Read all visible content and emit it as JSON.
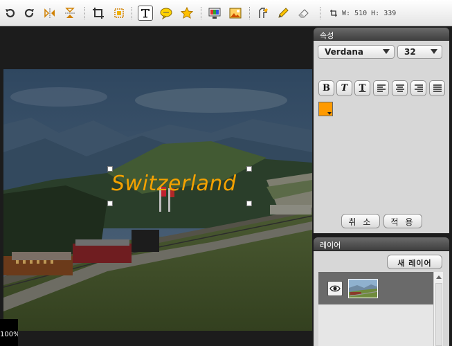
{
  "toolbar": {
    "tools": [
      {
        "name": "undo-icon"
      },
      {
        "name": "redo-icon"
      },
      {
        "name": "flip-horizontal-icon"
      },
      {
        "name": "flip-vertical-icon"
      },
      {
        "name": "crop-icon"
      },
      {
        "name": "resize-icon"
      },
      {
        "name": "text-tool-icon"
      },
      {
        "name": "speech-bubble-icon"
      },
      {
        "name": "star-icon"
      },
      {
        "name": "color-adjust-icon"
      },
      {
        "name": "image-filter-icon"
      },
      {
        "name": "brush-icon"
      },
      {
        "name": "pencil-icon"
      },
      {
        "name": "eraser-icon"
      }
    ],
    "size_label": "W: 510 H: 339"
  },
  "canvas": {
    "overlay_text": "Switzerland",
    "overlay_color": "#f4a100",
    "zoom": "100%"
  },
  "properties_panel": {
    "title": "속성",
    "font_family": "Verdana",
    "font_size": "32",
    "format_buttons": [
      {
        "label": "B",
        "name": "bold-button"
      },
      {
        "label": "T",
        "name": "italic-button"
      },
      {
        "label": "T",
        "name": "underline-button"
      }
    ],
    "align_buttons": [
      "align-left-icon",
      "align-center-icon",
      "align-right-icon",
      "align-justify-icon"
    ],
    "text_color": "#ff9a00",
    "cancel_label": "취 소",
    "apply_label": "적 용"
  },
  "layers_panel": {
    "title": "레이어",
    "new_layer_label": "새 레이어"
  }
}
